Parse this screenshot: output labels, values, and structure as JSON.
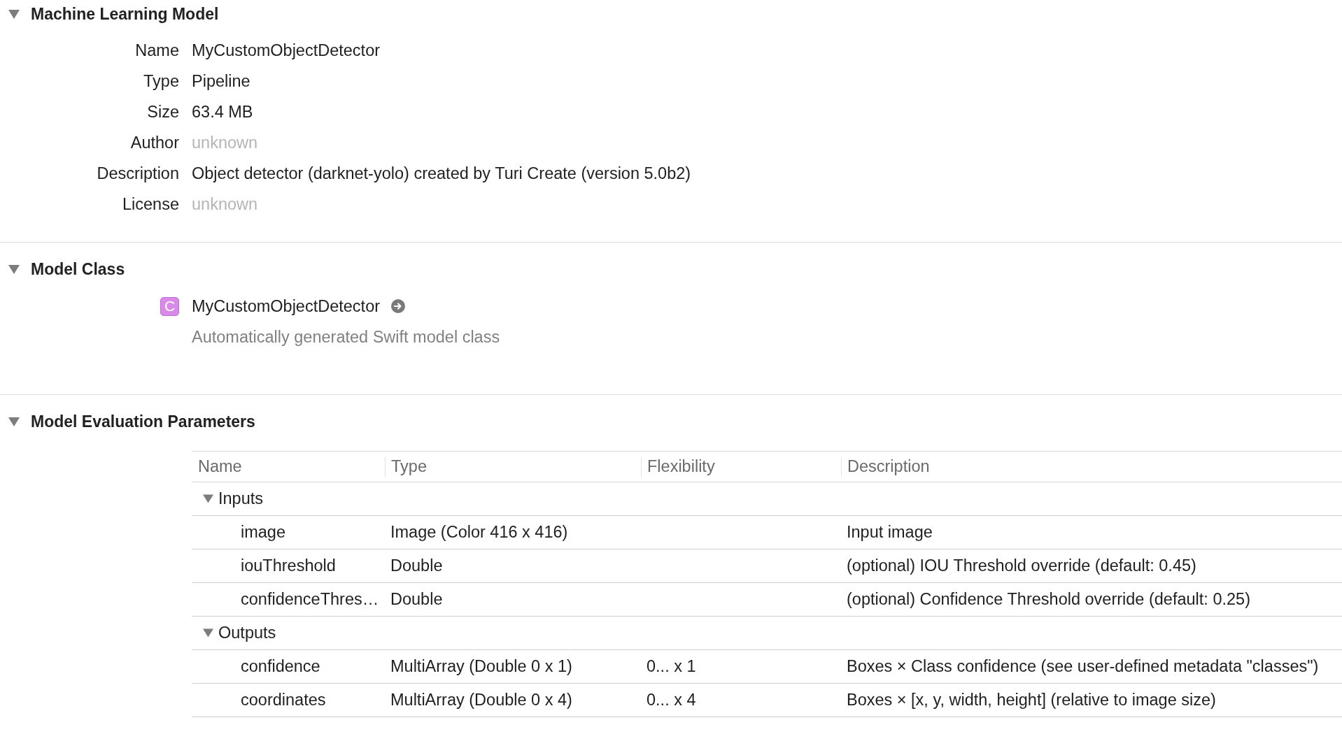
{
  "sections": [
    {
      "kind": "properties",
      "title": "Machine Learning Model",
      "expanded": true,
      "fields": [
        {
          "label": "Name",
          "value": "MyCustomObjectDetector"
        },
        {
          "label": "Type",
          "value": "Pipeline"
        },
        {
          "label": "Size",
          "value": "63.4 MB"
        },
        {
          "label": "Author",
          "placeholder": "unknown"
        },
        {
          "label": "Description",
          "value": "Object detector (darknet-yolo) created by Turi Create (version 5.0b2)"
        },
        {
          "label": "License",
          "placeholder": "unknown"
        }
      ]
    },
    {
      "kind": "class",
      "title": "Model Class",
      "expanded": true,
      "class": {
        "icon_letter": "C",
        "name": "MyCustomObjectDetector",
        "description": "Automatically generated Swift model class"
      }
    },
    {
      "kind": "parameters",
      "title": "Model Evaluation Parameters",
      "expanded": true,
      "table": {
        "columns": [
          "Name",
          "Type",
          "Flexibility",
          "Description"
        ],
        "groups": [
          {
            "title": "Inputs",
            "expanded": true,
            "rows": [
              {
                "name": "image",
                "type": "Image (Color 416 x 416)",
                "description": "Input image"
              },
              {
                "name": "iouThreshold",
                "type": "Double",
                "description": "(optional) IOU Threshold override (default: 0.45)"
              },
              {
                "name": "confidenceThres…",
                "type": "Double",
                "description": "(optional) Confidence Threshold override (default: 0.25)"
              }
            ]
          },
          {
            "title": "Outputs",
            "expanded": true,
            "rows": [
              {
                "name": "confidence",
                "type": "MultiArray (Double 0 x 1)",
                "flexibility": "0... x 1",
                "description": "Boxes × Class confidence (see user-defined metadata \"classes\")"
              },
              {
                "name": "coordinates",
                "type": "MultiArray (Double 0 x 4)",
                "flexibility": "0... x 4",
                "description": "Boxes × [x, y, width, height] (relative to image size)"
              }
            ]
          }
        ]
      }
    }
  ]
}
